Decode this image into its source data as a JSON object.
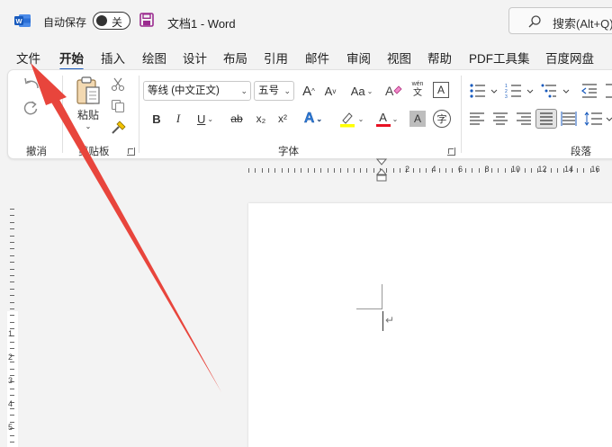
{
  "titlebar": {
    "autosave_label": "自动保存",
    "autosave_state": "关",
    "doc_title": "文档1 - Word",
    "search_placeholder": "搜索(Alt+Q)"
  },
  "tabs": [
    "文件",
    "开始",
    "插入",
    "绘图",
    "设计",
    "布局",
    "引用",
    "邮件",
    "审阅",
    "视图",
    "帮助",
    "PDF工具集",
    "百度网盘"
  ],
  "active_tab": "开始",
  "ribbon": {
    "groups": {
      "undo": "撤消",
      "clipboard": "剪贴板",
      "font": "字体",
      "paragraph": "段落"
    },
    "paste_label": "粘贴",
    "font_name": "等线 (中文正文)",
    "font_size": "五号",
    "grow_font": "A",
    "shrink_font": "A",
    "change_case": "Aa",
    "phonetic_top": "wén",
    "phonetic_bottom": "文",
    "bold": "B",
    "italic": "I",
    "underline": "U",
    "strike": "ab",
    "subscript": "x₂",
    "superscript": "x²",
    "text_effects": "A",
    "highlight": "A",
    "font_color": "A",
    "char_shading": "A",
    "enclose_char": "字"
  },
  "ruler": {
    "h_numbers": [
      "2",
      "4",
      "6",
      "8",
      "10",
      "12",
      "14",
      "16"
    ],
    "v_numbers": [
      "1",
      "2",
      "3",
      "4",
      "5"
    ]
  },
  "colors": {
    "accent": "#185abd",
    "arrow": "#e8453c",
    "highlight": "#ffff00",
    "font_color": "#e81123",
    "word_blue": "#185abd",
    "save_purple": "#9b2b8f"
  }
}
